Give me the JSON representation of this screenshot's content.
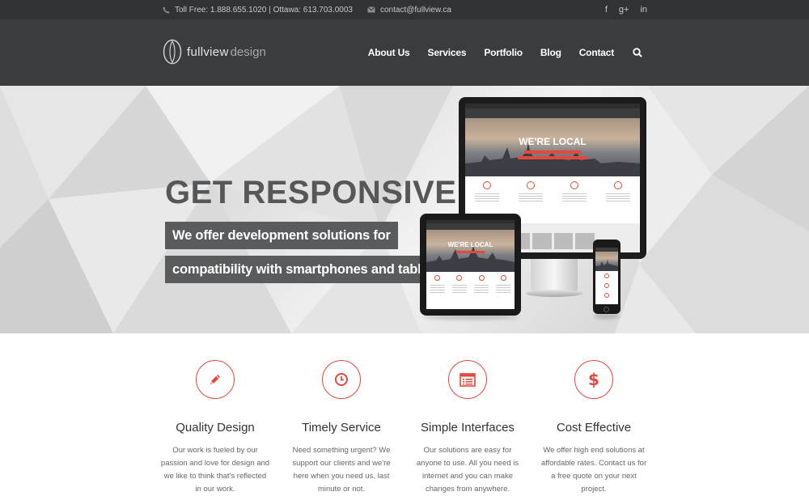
{
  "topbar": {
    "phone_text": "Toll Free: 1.888.655.1020 | Ottawa: 613.703.0003",
    "email_text": "contact@fullview.ca",
    "social": [
      "f",
      "g+",
      "in"
    ]
  },
  "header": {
    "brand_part1": "fullview",
    "brand_part2": "design",
    "nav": [
      "About Us",
      "Services",
      "Portfolio",
      "Blog",
      "Contact"
    ]
  },
  "hero": {
    "title": "GET RESPONSIVE",
    "line1": "We offer development solutions for",
    "line2": "compatibility with smartphones and tablets",
    "device_screen_text": "WE'RE LOCAL"
  },
  "features": [
    {
      "icon": "pencil-icon",
      "title": "Quality Design",
      "desc": "Our work is fueled by our passion and love for design and we like to think that's reflected in our work."
    },
    {
      "icon": "clock-icon",
      "title": "Timely Service",
      "desc": "Need something urgent? We support our clients and we're here when you need us, last minute or not."
    },
    {
      "icon": "list-window-icon",
      "title": "Simple Interfaces",
      "desc": "Our solutions are easy for anyone to use. All you need is internet and you can make changes from anywhere."
    },
    {
      "icon": "dollar-icon",
      "title": "Cost Effective",
      "desc": "We offer high end solutions at affordable rates. Contact us for a free quote on your next project."
    }
  ],
  "colors": {
    "accent": "#e2483d",
    "topbar": "#303234",
    "header": "#3a3c3e",
    "hero_box": "#5a5b5d"
  }
}
